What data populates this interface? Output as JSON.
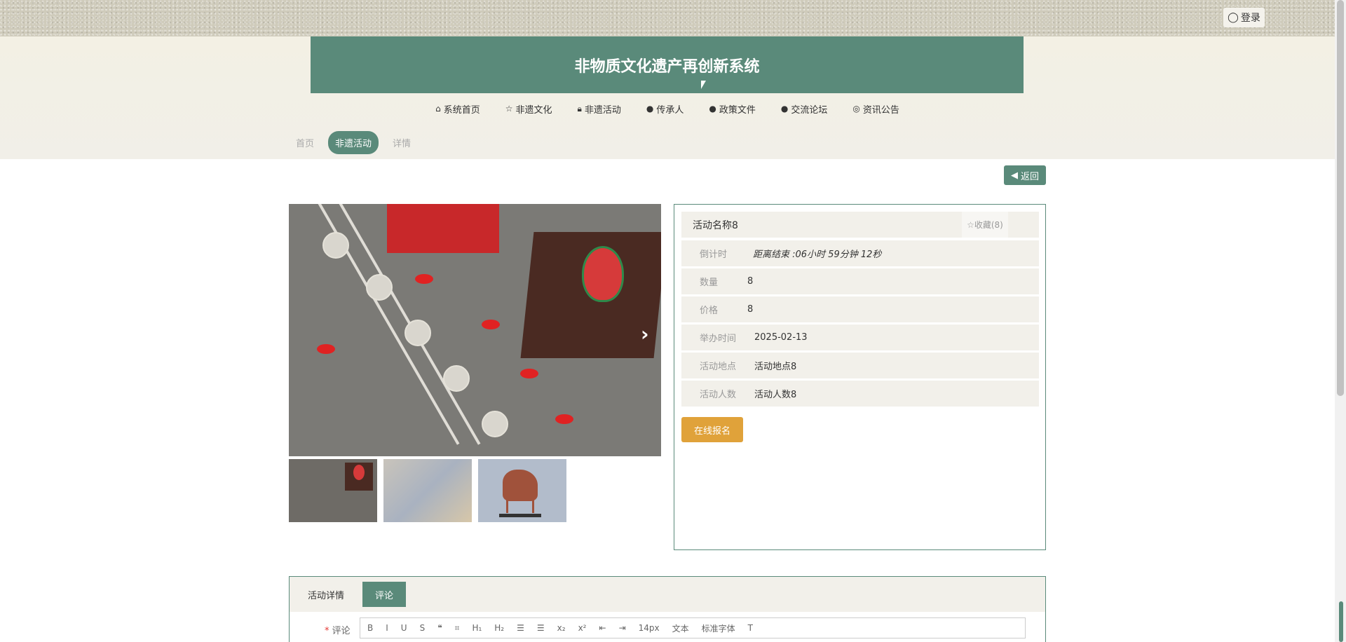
{
  "header": {
    "login_label": "登录",
    "title": "非物质文化遗产再创新系统"
  },
  "nav": [
    {
      "label": "系统首页",
      "icon": "home-icon"
    },
    {
      "label": "非遗文化",
      "icon": "star-icon"
    },
    {
      "label": "非遗活动",
      "icon": "lock-icon"
    },
    {
      "label": "传承人",
      "icon": "info-icon"
    },
    {
      "label": "政策文件",
      "icon": "question-icon"
    },
    {
      "label": "交流论坛",
      "icon": "info-italic-icon"
    },
    {
      "label": "资讯公告",
      "icon": "globe-icon"
    }
  ],
  "breadcrumb": {
    "home": "首页",
    "section": "非遗活动",
    "current": "详情"
  },
  "back_label": "返回",
  "activity": {
    "name": "活动名称8",
    "favorite_label": "☆收藏(8)",
    "fields": [
      {
        "label": "倒计时",
        "value": "距离结束 :06小时 59分钟 12秒"
      },
      {
        "label": "数量",
        "value": "8"
      },
      {
        "label": "价格",
        "value": "8"
      },
      {
        "label": "举办时间",
        "value": "2025-02-13"
      },
      {
        "label": "活动地点",
        "value": "活动地点8"
      },
      {
        "label": "活动人数",
        "value": "活动人数8"
      }
    ],
    "signup_label": "在线报名"
  },
  "tabs": [
    {
      "label": "活动详情"
    },
    {
      "label": "评论"
    }
  ],
  "comment": {
    "label": "评论",
    "toolbar": [
      "B",
      "I",
      "U",
      "S",
      "❝",
      "⌗",
      "H₁",
      "H₂",
      "☰",
      "☰",
      "x₂",
      "x²",
      "⇤",
      "⇥",
      "14px",
      "文本",
      "标准字体",
      "T"
    ]
  }
}
